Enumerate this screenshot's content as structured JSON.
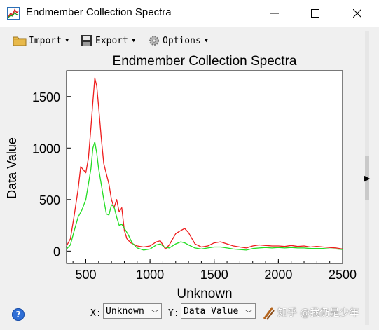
{
  "window": {
    "title": "Endmember Collection Spectra"
  },
  "toolbar": {
    "import_label": "Import",
    "export_label": "Export",
    "options_label": "Options"
  },
  "bottom": {
    "x_label": "X:",
    "x_value": "Unknown",
    "y_label": "Y:",
    "y_value": "Data Value",
    "watermark": "知乎 @我仍是少年"
  },
  "colors": {
    "red_series": "#ee1c1c",
    "green_series": "#22dd22"
  },
  "chart_data": {
    "type": "line",
    "title": "Endmember Collection Spectra",
    "xlabel": "Unknown",
    "ylabel": "Data Value",
    "xlim": [
      350,
      2500
    ],
    "ylim": [
      -120,
      1750
    ],
    "xticks": [
      500,
      1000,
      1500,
      2000,
      2500
    ],
    "yticks": [
      0,
      500,
      1000,
      1500
    ],
    "grid": false,
    "series": [
      {
        "color": "#ee1c1c",
        "points": [
          [
            350,
            50
          ],
          [
            380,
            120
          ],
          [
            410,
            350
          ],
          [
            440,
            600
          ],
          [
            460,
            820
          ],
          [
            480,
            790
          ],
          [
            500,
            760
          ],
          [
            520,
            900
          ],
          [
            540,
            1200
          ],
          [
            555,
            1450
          ],
          [
            570,
            1680
          ],
          [
            585,
            1600
          ],
          [
            600,
            1400
          ],
          [
            620,
            1100
          ],
          [
            640,
            850
          ],
          [
            660,
            750
          ],
          [
            680,
            650
          ],
          [
            700,
            500
          ],
          [
            720,
            420
          ],
          [
            740,
            500
          ],
          [
            760,
            380
          ],
          [
            780,
            420
          ],
          [
            800,
            200
          ],
          [
            820,
            120
          ],
          [
            850,
            80
          ],
          [
            900,
            50
          ],
          [
            950,
            40
          ],
          [
            1000,
            50
          ],
          [
            1050,
            90
          ],
          [
            1080,
            100
          ],
          [
            1100,
            60
          ],
          [
            1120,
            20
          ],
          [
            1150,
            60
          ],
          [
            1200,
            170
          ],
          [
            1240,
            200
          ],
          [
            1270,
            220
          ],
          [
            1300,
            180
          ],
          [
            1350,
            70
          ],
          [
            1400,
            40
          ],
          [
            1450,
            50
          ],
          [
            1500,
            80
          ],
          [
            1550,
            90
          ],
          [
            1600,
            70
          ],
          [
            1650,
            50
          ],
          [
            1700,
            40
          ],
          [
            1750,
            30
          ],
          [
            1800,
            50
          ],
          [
            1850,
            60
          ],
          [
            1900,
            55
          ],
          [
            1950,
            50
          ],
          [
            2000,
            50
          ],
          [
            2050,
            45
          ],
          [
            2100,
            55
          ],
          [
            2150,
            45
          ],
          [
            2200,
            50
          ],
          [
            2250,
            40
          ],
          [
            2300,
            45
          ],
          [
            2350,
            40
          ],
          [
            2400,
            35
          ],
          [
            2450,
            30
          ],
          [
            2500,
            20
          ]
        ]
      },
      {
        "color": "#22dd22",
        "points": [
          [
            350,
            20
          ],
          [
            380,
            60
          ],
          [
            410,
            200
          ],
          [
            440,
            330
          ],
          [
            470,
            400
          ],
          [
            500,
            500
          ],
          [
            520,
            650
          ],
          [
            540,
            800
          ],
          [
            555,
            1000
          ],
          [
            570,
            1060
          ],
          [
            585,
            950
          ],
          [
            600,
            800
          ],
          [
            620,
            650
          ],
          [
            640,
            500
          ],
          [
            660,
            360
          ],
          [
            680,
            350
          ],
          [
            700,
            450
          ],
          [
            720,
            430
          ],
          [
            740,
            330
          ],
          [
            760,
            250
          ],
          [
            780,
            260
          ],
          [
            800,
            220
          ],
          [
            830,
            160
          ],
          [
            860,
            80
          ],
          [
            900,
            30
          ],
          [
            950,
            10
          ],
          [
            1000,
            20
          ],
          [
            1050,
            60
          ],
          [
            1080,
            70
          ],
          [
            1110,
            40
          ],
          [
            1150,
            30
          ],
          [
            1200,
            70
          ],
          [
            1240,
            90
          ],
          [
            1270,
            80
          ],
          [
            1300,
            60
          ],
          [
            1350,
            30
          ],
          [
            1400,
            20
          ],
          [
            1450,
            30
          ],
          [
            1500,
            40
          ],
          [
            1550,
            40
          ],
          [
            1600,
            30
          ],
          [
            1650,
            20
          ],
          [
            1700,
            15
          ],
          [
            1750,
            10
          ],
          [
            1800,
            25
          ],
          [
            1850,
            30
          ],
          [
            1900,
            35
          ],
          [
            1950,
            30
          ],
          [
            2000,
            35
          ],
          [
            2050,
            30
          ],
          [
            2100,
            35
          ],
          [
            2150,
            30
          ],
          [
            2200,
            30
          ],
          [
            2250,
            25
          ],
          [
            2300,
            25
          ],
          [
            2350,
            25
          ],
          [
            2400,
            20
          ],
          [
            2450,
            20
          ],
          [
            2500,
            15
          ]
        ]
      }
    ]
  }
}
